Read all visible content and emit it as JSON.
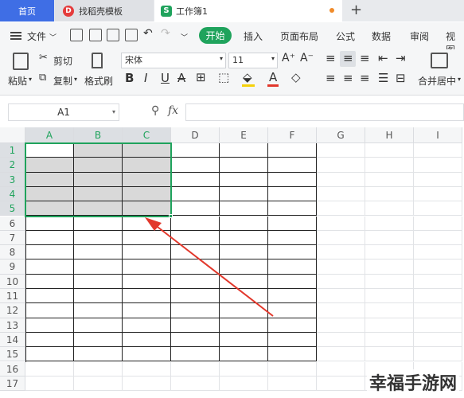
{
  "tabs": {
    "home": "首页",
    "docer": "找稻壳模板",
    "docer_icon": "D",
    "workbook": "工作簿1",
    "workbook_icon": "S",
    "add": "+"
  },
  "menu": {
    "file": "文件",
    "start": "开始",
    "insert": "插入",
    "page_layout": "页面布局",
    "formula": "公式",
    "data": "数据",
    "review": "审阅",
    "view": "视图"
  },
  "ribbon": {
    "paste": "粘贴",
    "cut": "剪切",
    "copy": "复制",
    "format_painter": "格式刷",
    "font_name": "宋体",
    "font_size": "11",
    "bold": "B",
    "italic": "I",
    "underline": "U",
    "merge_center": "合并居中"
  },
  "formula_bar": {
    "cell_ref": "A1",
    "fx": "fx",
    "value": ""
  },
  "grid": {
    "columns": [
      "A",
      "B",
      "C",
      "D",
      "E",
      "F",
      "G",
      "H",
      "I"
    ],
    "rows": [
      "1",
      "2",
      "3",
      "4",
      "5",
      "6",
      "7",
      "8",
      "9",
      "10",
      "11",
      "12",
      "13",
      "14",
      "15",
      "16",
      "17"
    ],
    "bordered_rows": 15,
    "bordered_cols": 6,
    "selection": {
      "cols": [
        "A",
        "B",
        "C"
      ],
      "rows": [
        "1",
        "2",
        "3",
        "4",
        "5"
      ]
    }
  },
  "watermark": "幸福手游网",
  "colors": {
    "accent_green": "#1fa35c",
    "home_tab_blue": "#3f6ee5",
    "arrow_red": "#e2382c"
  }
}
